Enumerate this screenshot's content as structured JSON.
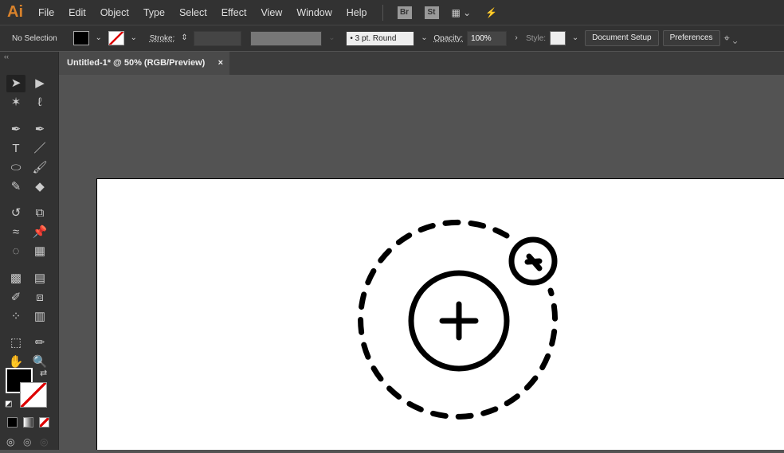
{
  "app": {
    "logo": "Ai",
    "menu": [
      "File",
      "Edit",
      "Object",
      "Type",
      "Select",
      "Effect",
      "View",
      "Window",
      "Help"
    ],
    "icons": [
      "Br",
      "St"
    ]
  },
  "control": {
    "selection": "No Selection",
    "stroke_label": "Stroke:",
    "brush": "3 pt. Round",
    "opacity_label": "Opacity:",
    "opacity": "100%",
    "style_label": "Style:",
    "document_setup": "Document Setup",
    "preferences": "Preferences",
    "fill_color": "#000000"
  },
  "tab": {
    "title": "Untitled-1* @ 50% (RGB/Preview)",
    "close": "×"
  },
  "tools": [
    "selection",
    "direct-selection",
    "magic-wand",
    "lasso",
    "pen",
    "curvature",
    "type",
    "line",
    "ellipse",
    "paintbrush",
    "shaper",
    "eraser",
    "rotate",
    "scale",
    "warp",
    "puppet-warp",
    "shape-builder",
    "perspective-grid",
    "mesh",
    "gradient",
    "eyedropper",
    "blend",
    "symbol-sprayer",
    "column-graph",
    "artboard",
    "slice",
    "hand",
    "zoom"
  ]
}
